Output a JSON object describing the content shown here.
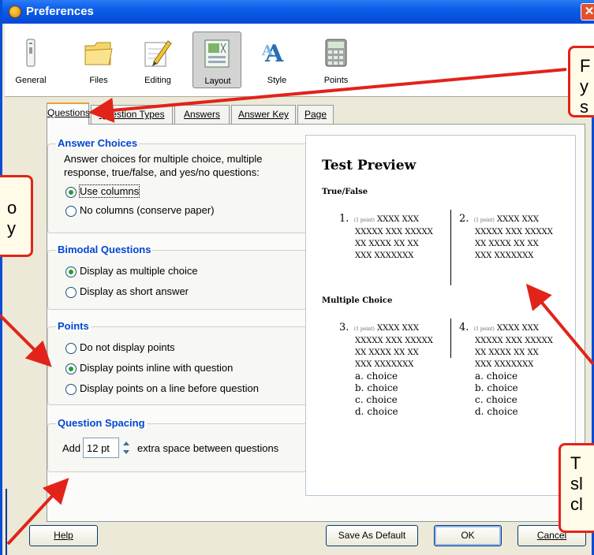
{
  "window": {
    "title": "Preferences",
    "close_glyph": "✕"
  },
  "toolbar": {
    "items": [
      {
        "label": "General",
        "icon": "general-icon"
      },
      {
        "label": "Files",
        "icon": "folder-icon"
      },
      {
        "label": "Editing",
        "icon": "pencil-icon"
      },
      {
        "label": "Layout",
        "icon": "layout-icon",
        "active": true
      },
      {
        "label": "Style",
        "icon": "style-icon"
      },
      {
        "label": "Points",
        "icon": "calculator-icon"
      }
    ]
  },
  "tabs": [
    "Questions",
    "Question Types",
    "Answers",
    "Answer Key",
    "Page"
  ],
  "answer_choices": {
    "title": "Answer Choices",
    "desc_line1": "Answer choices for multiple choice, multiple",
    "desc_line2": "response, true/false, and yes/no questions:",
    "options": [
      "Use columns",
      "No columns (conserve paper)"
    ],
    "selected": "Use columns"
  },
  "bimodal": {
    "title": "Bimodal Questions",
    "options": [
      "Display as multiple choice",
      "Display as short answer"
    ],
    "selected": "Display as multiple choice"
  },
  "points": {
    "title": "Points",
    "options": [
      "Do not display points",
      "Display points inline with question",
      "Display points on a line before question"
    ],
    "selected": "Display points inline with question"
  },
  "spacing": {
    "title": "Question Spacing",
    "prefix": "Add",
    "value": "12 pt",
    "suffix": "extra space between questions"
  },
  "preview": {
    "title": "Test Preview",
    "section_tf": "True/False",
    "section_mc": "Multiple Choice",
    "points_label": "(1 point)",
    "q_line1": "XXXX XXX",
    "q_line2": "XXXXX XXX XXXXX",
    "q_line3": "XX XXXX XX XX",
    "q_line4": "XXX XXXXXXX",
    "numbers": [
      "1.",
      "2.",
      "3.",
      "4."
    ],
    "choice_letters": [
      "a.",
      "b.",
      "c.",
      "d."
    ],
    "choice_word": "choice"
  },
  "buttons": {
    "help": "Help",
    "save_default": "Save As Default",
    "ok": "OK",
    "cancel": "Cancel"
  },
  "callouts": {
    "top_right": "F\ny\ns",
    "left": "o\ny",
    "bottom_right": "T\nsl\ncl"
  },
  "colors": {
    "callout_border": "#e2231a",
    "title_blue": "#0a5ee8",
    "group_title": "#0046d5"
  }
}
